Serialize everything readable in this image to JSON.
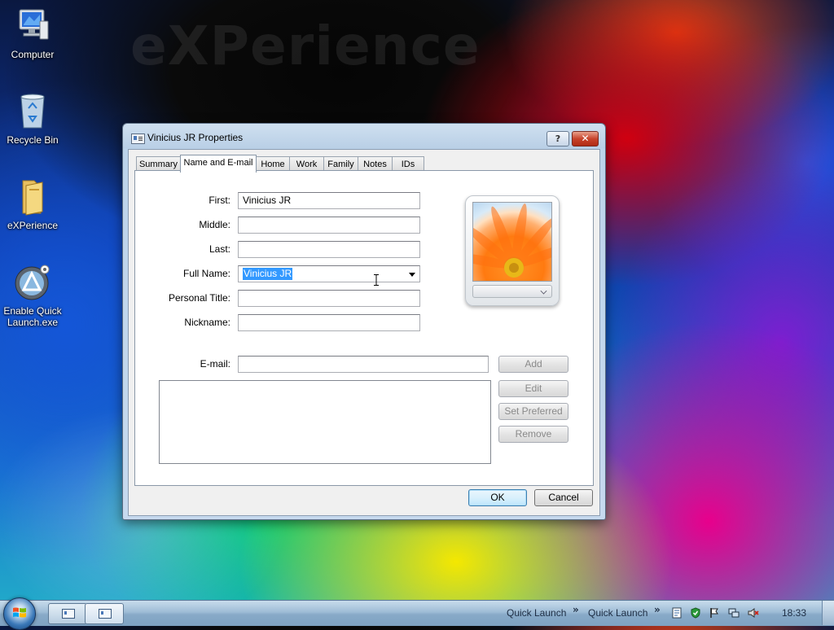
{
  "desktop": {
    "watermark": "eXPerience",
    "icons": [
      {
        "label": "Computer"
      },
      {
        "label": "Recycle Bin"
      },
      {
        "label": "eXPerience"
      },
      {
        "label": "Enable Quick Launch.exe"
      }
    ]
  },
  "dialog": {
    "title": "Vinicius JR Properties",
    "help_label": "?",
    "close_label": "✕",
    "tabs": [
      "Summary",
      "Name and E-mail",
      "Home",
      "Work",
      "Family",
      "Notes",
      "IDs"
    ],
    "active_tab": "Name and E-mail",
    "fields": {
      "first": {
        "label": "First:",
        "value": "Vinicius JR"
      },
      "middle": {
        "label": "Middle:",
        "value": ""
      },
      "last": {
        "label": "Last:",
        "value": ""
      },
      "full_name": {
        "label": "Full Name:",
        "value": "Vinicius JR"
      },
      "personal_title": {
        "label": "Personal Title:",
        "value": ""
      },
      "nickname": {
        "label": "Nickname:",
        "value": ""
      },
      "email": {
        "label": "E-mail:",
        "value": ""
      }
    },
    "email_buttons": {
      "add": "Add",
      "edit": "Edit",
      "set_preferred": "Set Preferred",
      "remove": "Remove"
    },
    "ok_label": "OK",
    "cancel_label": "Cancel"
  },
  "taskbar": {
    "quick_launch_1": "Quick Launch",
    "quick_launch_2": "Quick Launch",
    "chevron": "»",
    "clock": "18:33"
  },
  "colors": {
    "selection": "#3399ff",
    "close_button": "#c8442c",
    "default_button_border": "#3c7fb1"
  }
}
